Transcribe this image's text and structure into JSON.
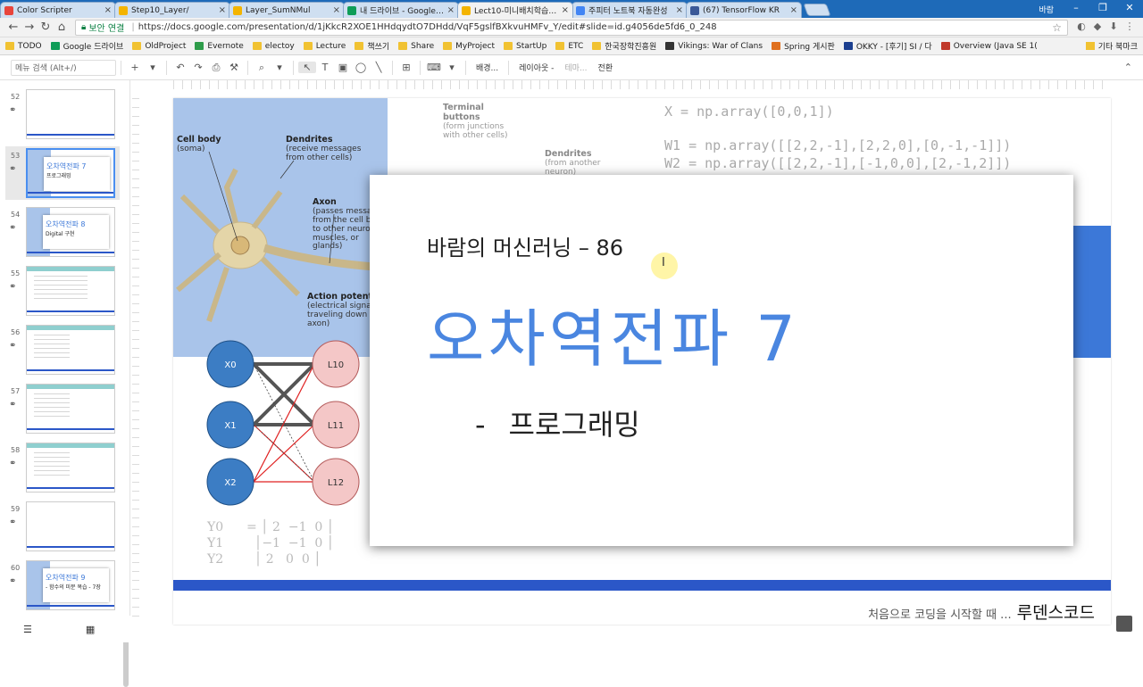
{
  "browser": {
    "tabs": [
      {
        "title": "Color Scripter",
        "color": "#e8453c",
        "active": false
      },
      {
        "title": "Step10_Layer/",
        "color": "#f4b400",
        "active": false
      },
      {
        "title": "Layer_SumNMul",
        "color": "#f4b400",
        "active": false
      },
      {
        "title": "내 드라이브 - Google 드",
        "color": "#0f9d58",
        "active": false
      },
      {
        "title": "Lect10-미니배치학습구현",
        "color": "#f4b400",
        "active": true
      },
      {
        "title": "주피터 노트북 자동완성",
        "color": "#4285f4",
        "active": false
      },
      {
        "title": "(67) TensorFlow KR",
        "color": "#3b5998",
        "active": false
      }
    ],
    "user": "바람",
    "secure_label": "보안 연결",
    "url": "https://docs.google.com/presentation/d/1jKkcR2XOE1HHdqydtO7DHdd/VqF5gslfBXkvuHMFv_Y/edit#slide=id.g4056de5fd6_0_248",
    "bookmarks": [
      "TODO",
      "Google 드라이브",
      "OldProject",
      "Evernote",
      "electoy",
      "Lecture",
      "책쓰기",
      "Share",
      "MyProject",
      "StartUp",
      "ETC",
      "한국장학진흥원",
      "Vikings: War of Clans",
      "Spring 게시판",
      "OKKY - [후기] SI / 다",
      "Overview (Java SE 1("
    ],
    "bookmarks_other": "기타 북마크"
  },
  "toolbar": {
    "menu_search": "메뉴 검색 (Alt+/)",
    "background_label": "배경...",
    "layout_label": "레이아웃 -",
    "theme_label": "테마...",
    "transition_label": "전환"
  },
  "filmstrip": {
    "slides": [
      {
        "num": "52",
        "type": "blank"
      },
      {
        "num": "53",
        "type": "title",
        "title": "오차역전파 7",
        "sub": "프로그래밍",
        "selected": true
      },
      {
        "num": "54",
        "type": "title",
        "title": "오차역전파 8",
        "sub": "Digital 구현",
        "selected": false
      },
      {
        "num": "55",
        "type": "code"
      },
      {
        "num": "56",
        "type": "diagram"
      },
      {
        "num": "57",
        "type": "diagram"
      },
      {
        "num": "58",
        "type": "diagram"
      },
      {
        "num": "59",
        "type": "blank"
      },
      {
        "num": "60",
        "type": "title",
        "title": "오차역전파 9",
        "sub": "- 함수의 미분 복습 - 7장",
        "selected": false
      }
    ]
  },
  "slide": {
    "neuron_labels": {
      "cell_body": "Cell body",
      "cell_body_sub": "(soma)",
      "dendrites": "Dendrites",
      "dendrites_sub": "(receive messages from other cells)",
      "axon": "Axon",
      "axon_sub": "(passes messages from the cell body to other neurons, muscles, or glands)",
      "action": "Action potential",
      "action_sub": "(electrical signal traveling down the axon)",
      "terminal": "Terminal buttons",
      "terminal_sub": "(form junctions with other cells)",
      "dendrites2": "Dendrites",
      "dendrites2_sub": "(from another neuron)"
    },
    "code_lines": [
      "X = np.array([0,0,1])",
      "W1 = np.array([[2,2,-1],[2,2,0],[0,-1,-1]])",
      "W2 = np.array([[2,2,-1],[-1,0,0],[2,-1,2]])"
    ],
    "nodes_input": [
      "X0",
      "X1",
      "X2"
    ],
    "nodes_hidden": [
      "L10",
      "L11",
      "L12"
    ],
    "matrix_left": [
      "Y0",
      "Y1",
      "Y2"
    ],
    "matrix_text": "[Y0 Y1 Y2] = [2 −1 0; −1 −1 0; 2 0 0] [... 1 0 0; 2 −1 2] [2 2 0; 0 −1 −1] [X1 X2]",
    "credit_small": "처음으로 코딩을 시작할 때 ...",
    "credit_big": "루덴스코드",
    "accent_color": "#2b57c8"
  },
  "overlay": {
    "subtitle": "바람의 머신러닝 – 86",
    "title": "오차역전파 7",
    "bullet_dash": "-",
    "bullet": "프로그래밍"
  }
}
